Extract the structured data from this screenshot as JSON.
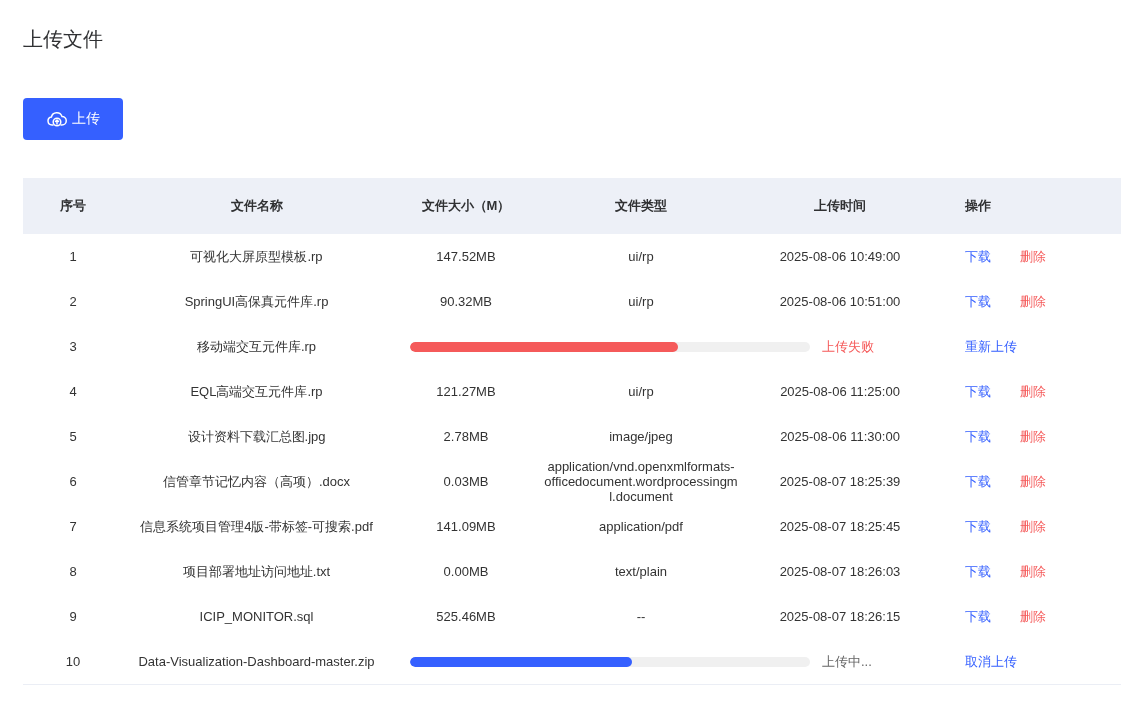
{
  "page_title": "上传文件",
  "upload_button": {
    "label": "上传"
  },
  "table": {
    "columns": [
      "序号",
      "文件名称",
      "文件大小（M）",
      "文件类型",
      "上传时间",
      "操作"
    ],
    "rows": [
      {
        "kind": "file",
        "index": "1",
        "name": "可视化大屏原型模板.rp",
        "size": "147.52MB",
        "type": "ui/rp",
        "time": "2025-08-06 10:49:00",
        "actions": [
          {
            "label": "下载",
            "kind": "primary"
          },
          {
            "label": "删除",
            "kind": "danger"
          }
        ]
      },
      {
        "kind": "file",
        "index": "2",
        "name": "SpringUI高保真元件库.rp",
        "size": "90.32MB",
        "type": "ui/rp",
        "time": "2025-08-06 10:51:00",
        "actions": [
          {
            "label": "下载",
            "kind": "primary"
          },
          {
            "label": "删除",
            "kind": "danger"
          }
        ]
      },
      {
        "kind": "progress",
        "index": "3",
        "name": "移动端交互元件库.rp",
        "level": 0.67,
        "status": "上传失败",
        "failed": true,
        "actions": [
          {
            "label": "重新上传",
            "kind": "primary"
          }
        ]
      },
      {
        "kind": "file",
        "index": "4",
        "name": "EQL高端交互元件库.rp",
        "size": "121.27MB",
        "type": "ui/rp",
        "time": "2025-08-06 11:25:00",
        "actions": [
          {
            "label": "下载",
            "kind": "primary"
          },
          {
            "label": "删除",
            "kind": "danger"
          }
        ]
      },
      {
        "kind": "file",
        "index": "5",
        "name": "设计资料下载汇总图.jpg",
        "size": "2.78MB",
        "type": "image/jpeg",
        "time": "2025-08-06 11:30:00",
        "actions": [
          {
            "label": "下载",
            "kind": "primary"
          },
          {
            "label": "删除",
            "kind": "danger"
          }
        ]
      },
      {
        "kind": "file",
        "index": "6",
        "name": "信管章节记忆内容（高项）.docx",
        "size": "0.03MB",
        "type": "application/vnd.openxmlformats-officedocument.wordprocessingml.document",
        "time": "2025-08-07 18:25:39",
        "actions": [
          {
            "label": "下载",
            "kind": "primary"
          },
          {
            "label": "删除",
            "kind": "danger"
          }
        ]
      },
      {
        "kind": "file",
        "index": "7",
        "name": "信息系统项目管理4版-带标签-可搜索.pdf",
        "size": "141.09MB",
        "type": "application/pdf",
        "time": "2025-08-07 18:25:45",
        "actions": [
          {
            "label": "下载",
            "kind": "primary"
          },
          {
            "label": "删除",
            "kind": "danger"
          }
        ]
      },
      {
        "kind": "file",
        "index": "8",
        "name": "项目部署地址访问地址.txt",
        "size": "0.00MB",
        "type": "text/plain",
        "time": "2025-08-07 18:26:03",
        "actions": [
          {
            "label": "下载",
            "kind": "primary"
          },
          {
            "label": "删除",
            "kind": "danger"
          }
        ]
      },
      {
        "kind": "file",
        "index": "9",
        "name": "ICIP_MONITOR.sql",
        "size": "525.46MB",
        "type": "--",
        "time": "2025-08-07 18:26:15",
        "actions": [
          {
            "label": "下载",
            "kind": "primary"
          },
          {
            "label": "删除",
            "kind": "danger"
          }
        ]
      },
      {
        "kind": "progress",
        "index": "10",
        "name": "Data-Visualization-Dashboard-master.zip",
        "level": 0.555,
        "status": "上传中...",
        "failed": false,
        "actions": [
          {
            "label": "取消上传",
            "kind": "primary"
          }
        ]
      }
    ]
  }
}
